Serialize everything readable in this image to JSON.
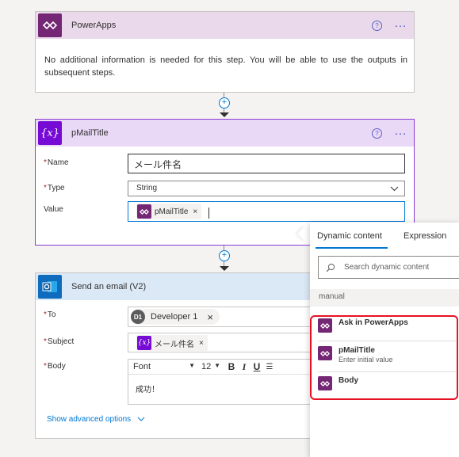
{
  "powerapps_card": {
    "title": "PowerApps",
    "help": "?",
    "more": "…",
    "info": "No additional information is needed for this step. You will be able to use the outputs in subsequent steps."
  },
  "variable_card": {
    "title": "pMailTitle",
    "icon_text": "{x}",
    "help": "?",
    "more": "…",
    "name_label": "Name",
    "name_value": "メール件名",
    "type_label": "Type",
    "type_value": "String",
    "value_label": "Value",
    "value_token": "pMailTitle",
    "required_mark": "*"
  },
  "email_card": {
    "title": "Send an email (V2)",
    "to_label": "To",
    "to_avatar": "D1",
    "to_value": "Developer 1",
    "subject_label": "Subject",
    "subject_token_icon": "{x}",
    "subject_token": "メール件名",
    "body_label": "Body",
    "font_value": "Font",
    "font_size": "12",
    "bold": "B",
    "italic": "I",
    "underline": "U",
    "body_text": "成功！",
    "advanced": "Show advanced options",
    "token_remove": "×"
  },
  "dynamic_panel": {
    "tab_dynamic": "Dynamic content",
    "tab_expression": "Expression",
    "search_placeholder": "Search dynamic content",
    "section": "manual",
    "items": [
      {
        "title": "Ask in PowerApps",
        "sub": ""
      },
      {
        "title": "pMailTitle",
        "sub": "Enter initial value"
      },
      {
        "title": "Body",
        "sub": ""
      }
    ]
  },
  "colors": {
    "powerapps_purple": "#742774",
    "variable_purple": "#770bd6",
    "outlook_blue": "#0f6cbd",
    "highlight_red": "#e81123",
    "accent_blue": "#0078d4"
  }
}
